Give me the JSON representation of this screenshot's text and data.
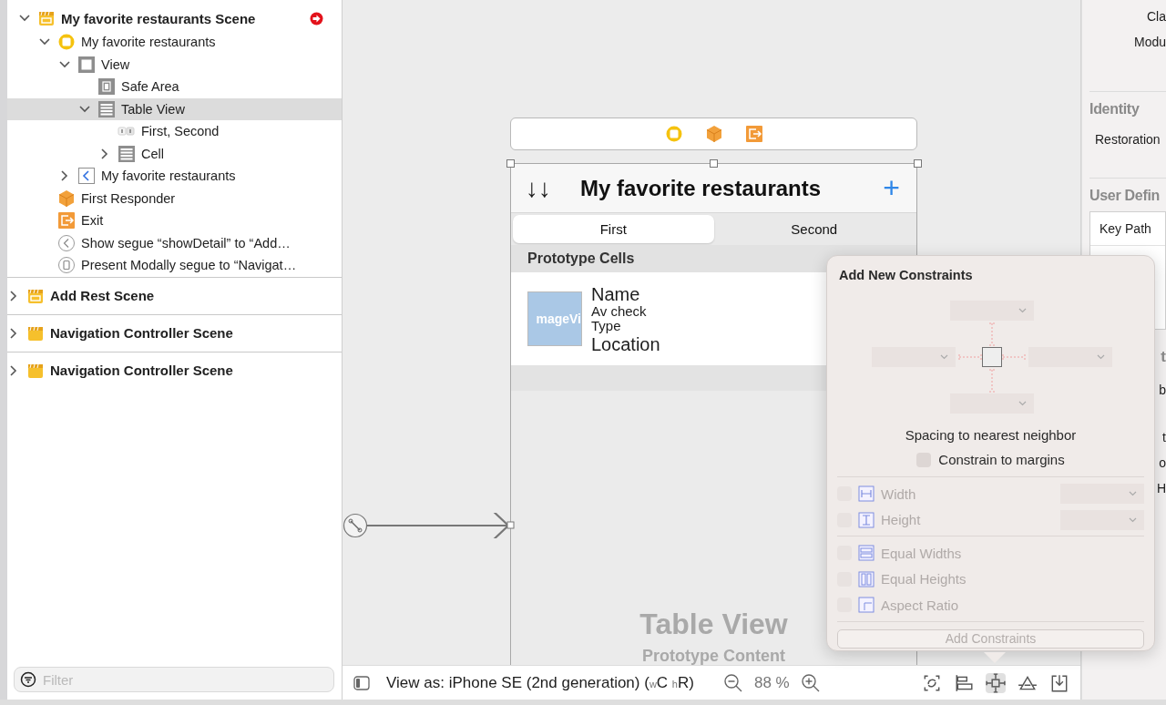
{
  "outline": {
    "items": [
      {
        "label": "My favorite restaurants Scene",
        "kind": "scene",
        "expanded": true,
        "selected": false,
        "warning": true,
        "children": [
          {
            "label": "My favorite restaurants",
            "kind": "controller",
            "expanded": true,
            "selected": false,
            "children": [
              {
                "label": "View",
                "kind": "view",
                "expanded": true,
                "selected": false,
                "children": [
                  {
                    "label": "Safe Area",
                    "kind": "safe-area",
                    "selected": false
                  },
                  {
                    "label": "Table View",
                    "kind": "table",
                    "expanded": true,
                    "selected": true,
                    "children": [
                      {
                        "label": "First, Second",
                        "kind": "segmented",
                        "selected": false
                      },
                      {
                        "label": "Cell",
                        "kind": "cell",
                        "expanded": false,
                        "selected": false
                      }
                    ]
                  }
                ]
              },
              {
                "label": "My favorite restaurants",
                "kind": "nav-item",
                "expanded": false,
                "selected": false
              }
            ]
          },
          {
            "label": "First Responder",
            "kind": "responder",
            "selected": false
          },
          {
            "label": "Exit",
            "kind": "exit",
            "selected": false
          },
          {
            "label": "Show segue “showDetail” to “Add…",
            "kind": "segue-show",
            "selected": false
          },
          {
            "label": "Present Modally segue to “Navigat…",
            "kind": "segue-modal",
            "selected": false
          }
        ]
      },
      {
        "label": "Add Rest Scene",
        "kind": "scene",
        "expanded": false,
        "selected": false,
        "warning": false
      },
      {
        "label": "Navigation Controller Scene",
        "kind": "nav-scene",
        "expanded": false,
        "selected": false,
        "warning": false
      },
      {
        "label": "Navigation Controller Scene",
        "kind": "nav-scene",
        "expanded": false,
        "selected": false,
        "warning": false
      }
    ],
    "filter": {
      "placeholder": "Filter"
    }
  },
  "canvas": {
    "nav_bar": {
      "left_button": "↓↓",
      "title": "My favorite restaurants",
      "right_button": "+"
    },
    "segments": [
      {
        "label": "First",
        "selected": true
      },
      {
        "label": "Second",
        "selected": false
      }
    ],
    "section_header": "Prototype Cells",
    "cell": {
      "image_label": "mageVi",
      "fields": [
        {
          "text": "Name",
          "kind": "large"
        },
        {
          "text": "Av check",
          "kind": "small"
        },
        {
          "text": "Type",
          "kind": "small"
        },
        {
          "text": "Location",
          "kind": "large"
        }
      ]
    },
    "placeholder_title": "Table View",
    "placeholder_subtitle": "Prototype Content"
  },
  "bottom_bar": {
    "view_as": "View as: iPhone SE (2nd generation)",
    "size_class": "($_{w}$C $_{h}$R)",
    "zoom": "88 %",
    "tools": [
      {
        "kind": "update-frames",
        "selected": false
      },
      {
        "kind": "align",
        "selected": false
      },
      {
        "kind": "add-constraints",
        "selected": true
      },
      {
        "kind": "resolve",
        "selected": false
      },
      {
        "kind": "embed",
        "selected": false
      }
    ]
  },
  "popover": {
    "title": "Add New Constraints",
    "caption": "Spacing to nearest neighbor",
    "margins": {
      "label": "Constrain to margins",
      "checked": false
    },
    "groups": [
      [
        {
          "label": "Width",
          "kind": "width",
          "checked": false,
          "disabled": true
        },
        {
          "label": "Height",
          "kind": "height",
          "checked": false,
          "disabled": true
        }
      ],
      [
        {
          "label": "Equal Widths",
          "kind": "equal-widths",
          "checked": false,
          "disabled": true
        },
        {
          "label": "Equal Heights",
          "kind": "equal-heights",
          "checked": false,
          "disabled": true
        },
        {
          "label": "Aspect Ratio",
          "kind": "aspect",
          "checked": false,
          "disabled": true
        }
      ]
    ],
    "button": {
      "label": "Add Constraints",
      "disabled": true
    }
  },
  "inspector": {
    "fields_top": [
      "Cla",
      "Modu"
    ],
    "identity": {
      "title": "Identity",
      "label": "Restoration"
    },
    "user_defined": {
      "title": "User Defin",
      "column": "Key Path"
    },
    "section_4": {
      "title": "t",
      "labels": [
        "b",
        "t",
        "o",
        "H"
      ]
    }
  }
}
